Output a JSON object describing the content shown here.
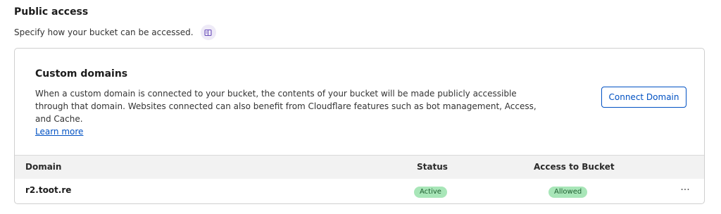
{
  "section": {
    "title": "Public access",
    "description": "Specify how your bucket can be accessed."
  },
  "custom_domains": {
    "title": "Custom domains",
    "body": "When a custom domain is connected to your bucket, the contents of your bucket will be made publicly accessible through that domain. Websites connected can also benefit from Cloudflare features such as bot management, Access, and Cache.",
    "learn_more": "Learn more",
    "connect_button": "Connect Domain"
  },
  "table": {
    "headers": {
      "domain": "Domain",
      "status": "Status",
      "access": "Access to Bucket"
    },
    "rows": [
      {
        "domain": "r2.toot.re",
        "status": "Active",
        "access": "Allowed"
      }
    ],
    "row_menu_glyph": "···"
  },
  "colors": {
    "accent": "#0051c3",
    "badge_bg": "#a8e6b8",
    "badge_text": "#1f5f31"
  }
}
